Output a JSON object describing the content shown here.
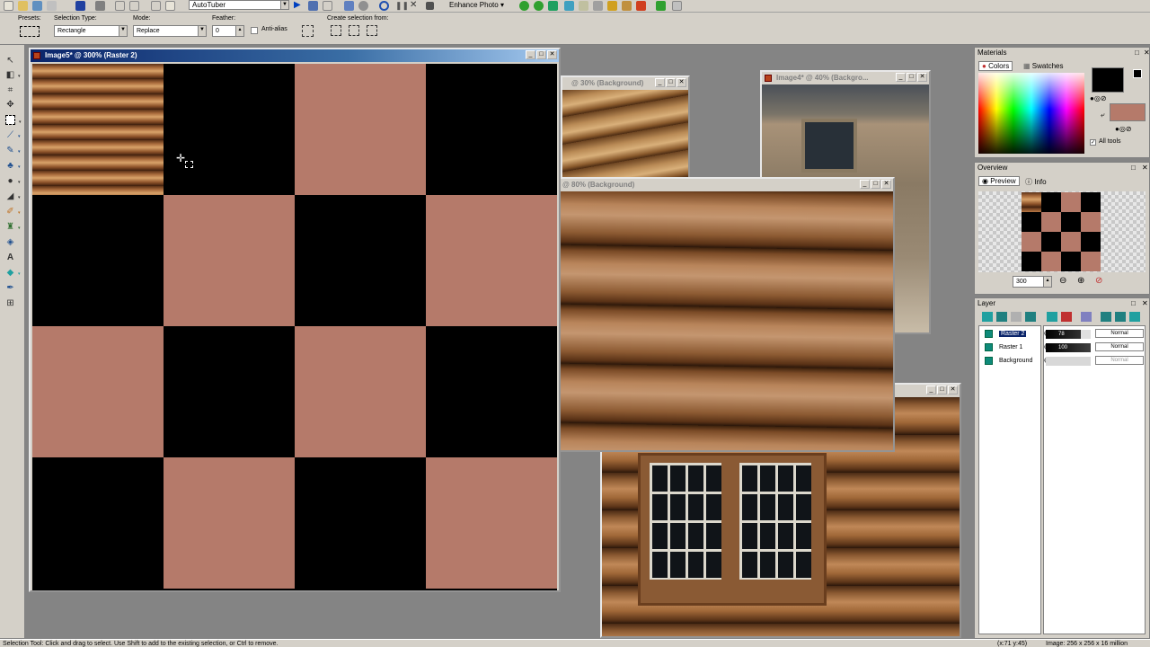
{
  "toolbar": {
    "script_dropdown": "AutoTuber",
    "enhance_photo": "Enhance Photo"
  },
  "options": {
    "presets_label": "Presets:",
    "selection_type_label": "Selection Type:",
    "selection_type_value": "Rectangle",
    "mode_label": "Mode:",
    "mode_value": "Replace",
    "feather_label": "Feather:",
    "feather_value": "0",
    "antialias_label": "Anti-alias",
    "create_selection_label": "Create selection from:"
  },
  "windows": {
    "main": {
      "title": "Image5* @ 300% (Raster 2)"
    },
    "logs30": {
      "title": "@ 30% (Background)"
    },
    "image4": {
      "title": "Image4* @ 40% (Backgro..."
    },
    "logs80": {
      "title": "@ 80% (Background)"
    },
    "window_img": {
      "title": ""
    }
  },
  "materials": {
    "title": "Materials",
    "tab_colors": "Colors",
    "tab_swatches": "Swatches",
    "all_tools": "All tools",
    "foreground": "#000000",
    "background": "#b57a6a"
  },
  "overview": {
    "title": "Overview",
    "tab_preview": "Preview",
    "tab_info": "Info",
    "zoom": "300"
  },
  "layers": {
    "title": "Layer",
    "items": [
      {
        "name": "Raster 2",
        "opacity": "78",
        "blend": "Normal",
        "selected": true
      },
      {
        "name": "Raster 1",
        "opacity": "100",
        "blend": "Normal",
        "selected": false
      },
      {
        "name": "Background",
        "opacity": "",
        "blend": "Normal",
        "selected": false
      }
    ]
  },
  "canvas": {
    "tile_color": "#b57a6a",
    "dark_color": "#000000"
  },
  "status": {
    "left": "Selection Tool: Click and drag to select. Use Shift to add to the existing selection, or Ctrl to remove.",
    "coords": "(x:71 y:45)",
    "image": "Image: 256 x 256 x 16 million"
  }
}
